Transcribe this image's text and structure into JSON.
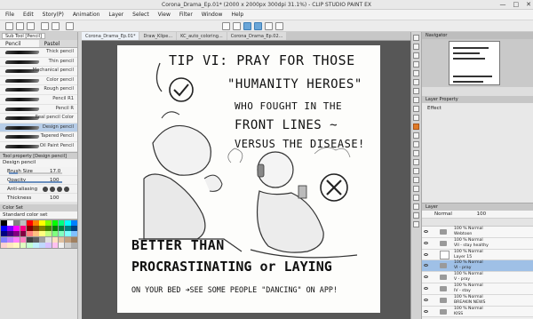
{
  "window": {
    "title": "Corona_Drama_Ep.01* (2000 x 2000px 300dpi 31.1%) - CLIP STUDIO PAINT EX",
    "controls": [
      "—",
      "□",
      "✕"
    ]
  },
  "menu": [
    "File",
    "Edit",
    "Story(P)",
    "Animation",
    "Layer",
    "Select",
    "View",
    "Filter",
    "Window",
    "Help"
  ],
  "subtool_panel": {
    "tabs": [
      "Sub Tool [Pencil]"
    ],
    "brush_tabs": [
      "Pencil",
      "Pastel"
    ],
    "brushes": [
      "Thick pencil",
      "Thin pencil",
      "Mechanical pencil",
      "Color pencil",
      "Rough pencil",
      "Pencil R1",
      "Pencil R",
      "Real pencil Color",
      "Design pencil",
      "Tapered Pencil",
      "Oil Paint Pencil"
    ],
    "selected_brush_index": 8
  },
  "tool_property": {
    "header": "Tool property [Design pencil]",
    "brush_name": "Design pencil",
    "brush_size_label": "Brush Size",
    "brush_size_value": "17.0",
    "brush_size_fill": 0.17,
    "opacity_label": "Opacity",
    "opacity_value": "100",
    "opacity_fill": 1.0,
    "antialias_label": "Anti-aliasing",
    "thickness_label": "Thickness",
    "thickness_value": "100"
  },
  "color_set": {
    "header": "Color Set",
    "selected": "Standard color set",
    "colors": [
      "#000000",
      "#ffffff",
      "#808080",
      "#c0c0c0",
      "#ff0000",
      "#ff8000",
      "#ffff00",
      "#80ff00",
      "#00ff00",
      "#00ff80",
      "#00ffff",
      "#0080ff",
      "#0000ff",
      "#8000ff",
      "#ff00ff",
      "#ff0080",
      "#800000",
      "#804000",
      "#808000",
      "#408000",
      "#008000",
      "#008040",
      "#008080",
      "#004080",
      "#000080",
      "#400080",
      "#800080",
      "#800040",
      "#ff8080",
      "#ffc080",
      "#ffff80",
      "#c0ff80",
      "#80ff80",
      "#80ffc0",
      "#80ffff",
      "#80c0ff",
      "#8080ff",
      "#c080ff",
      "#ff80ff",
      "#ff80c0",
      "#404040",
      "#606060",
      "#a0a0a0",
      "#e0e0e0",
      "#ffe0c0",
      "#e0c0a0",
      "#c0a080",
      "#a08060",
      "#ffd0d0",
      "#ffe8c0",
      "#fff8c0",
      "#e0ffc0",
      "#c0ffd0",
      "#c0f0ff",
      "#c0d8ff",
      "#d8c0ff",
      "#ffc0f0",
      "#f0f0f0",
      "#d0d0d0",
      "#b0b0b0"
    ]
  },
  "doc_tabs": [
    "Corona_Drama_Ep.01*",
    "Draw_Klipe...",
    "KC_auto_coloring...",
    "Corona_Drama_Ep.02..."
  ],
  "canvas": {
    "lines": [
      "TIP VI: PRAY FOR THOSE",
      "\"HUMANITY HEROES\"",
      "WHO FOUGHT IN THE",
      "FRONT LINES ~",
      "VERSUS THE DISEASE!",
      "BETTER THAN",
      "PROCRASTINATING or LAYING",
      "ON YOUR BED ➜SEE SOME PEOPLE \"DANCING\" ON APP!"
    ]
  },
  "navigator": {
    "header": "Navigator"
  },
  "layer_property": {
    "header": "Layer Property",
    "effect_label": "Effect"
  },
  "layers": {
    "header": "Layer",
    "blend_mode": "Normal",
    "opacity": "100",
    "rows": [
      {
        "line1": "100 % Normal",
        "line2": "Webtoon",
        "type": "folder",
        "selected": false
      },
      {
        "line1": "100 % Normal",
        "line2": "VII - stay healthy",
        "type": "folder",
        "selected": false
      },
      {
        "line1": "100 % Normal",
        "line2": "Layer 15",
        "type": "layer",
        "selected": false
      },
      {
        "line1": "100 % Normal",
        "line2": "VI - pray",
        "type": "folder",
        "selected": true
      },
      {
        "line1": "100 % Normal",
        "line2": "V - pray",
        "type": "folder",
        "selected": false
      },
      {
        "line1": "100 % Normal",
        "line2": "IV - stay",
        "type": "folder",
        "selected": false
      },
      {
        "line1": "100 % Normal",
        "line2": "BREAKIN NEWS",
        "type": "folder",
        "selected": false
      },
      {
        "line1": "100 % Normal",
        "line2": "KISS",
        "type": "folder",
        "selected": false
      }
    ]
  }
}
